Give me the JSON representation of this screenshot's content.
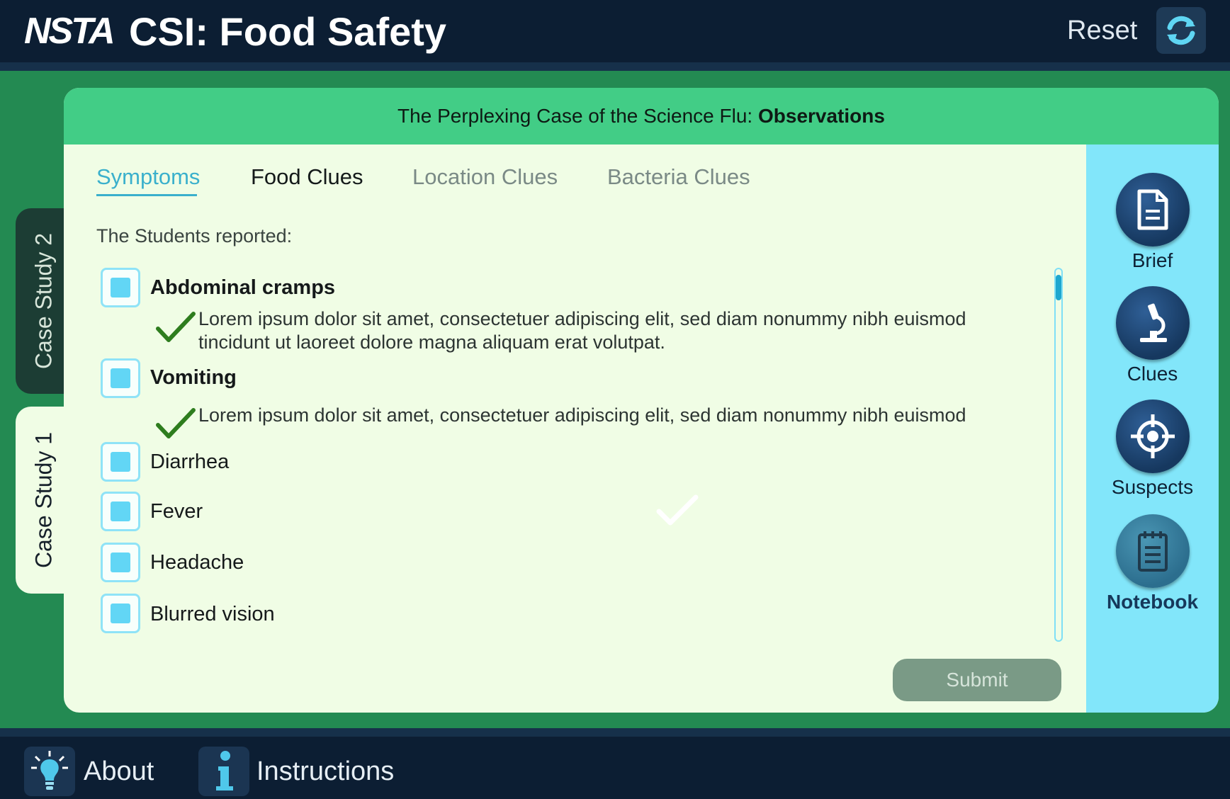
{
  "header": {
    "logo_text": "NSTA",
    "title": "CSI: Food Safety",
    "reset_label": "Reset"
  },
  "side_tabs": [
    {
      "label": "Case Study 2",
      "active": false
    },
    {
      "label": "Case Study 1",
      "active": true
    }
  ],
  "panel": {
    "title_prefix": "The Perplexing Case of the Science Flu: ",
    "title_bold": "Observations"
  },
  "tabs": [
    {
      "label": "Symptoms",
      "active": true
    },
    {
      "label": "Food Clues",
      "active": false
    },
    {
      "label": "Location Clues",
      "active": false
    },
    {
      "label": "Bacteria Clues",
      "active": false
    }
  ],
  "intro": "The Students reported:",
  "symptoms": [
    {
      "label": "Abdominal cramps",
      "bold": true,
      "note": "Lorem ipsum dolor sit amet, consectetuer adipiscing elit, sed diam nonummy nibh euismod tincidunt ut laoreet dolore magna aliquam erat volutpat."
    },
    {
      "label": "Vomiting",
      "bold": true,
      "note": "Lorem ipsum dolor sit amet, consectetuer adipiscing elit, sed diam nonummy nibh euismod"
    },
    {
      "label": "Diarrhea",
      "bold": false
    },
    {
      "label": "Fever",
      "bold": false
    },
    {
      "label": "Headache",
      "bold": false
    },
    {
      "label": "Blurred vision",
      "bold": false
    }
  ],
  "submit_label": "Submit",
  "rail": [
    {
      "label": "Brief",
      "icon": "document-icon"
    },
    {
      "label": "Clues",
      "icon": "microscope-icon"
    },
    {
      "label": "Suspects",
      "icon": "crosshair-icon"
    },
    {
      "label": "Notebook",
      "icon": "notebook-icon",
      "active": true
    }
  ],
  "footer": {
    "about_label": "About",
    "instructions_label": "Instructions"
  },
  "colors": {
    "header_bg": "#0c1e33",
    "stage_green": "#238a52",
    "panel_header": "#42cd86",
    "panel_bg": "#f0fde5",
    "rail_bg": "#82e6fa",
    "active_tab": "#3ab0cc"
  }
}
